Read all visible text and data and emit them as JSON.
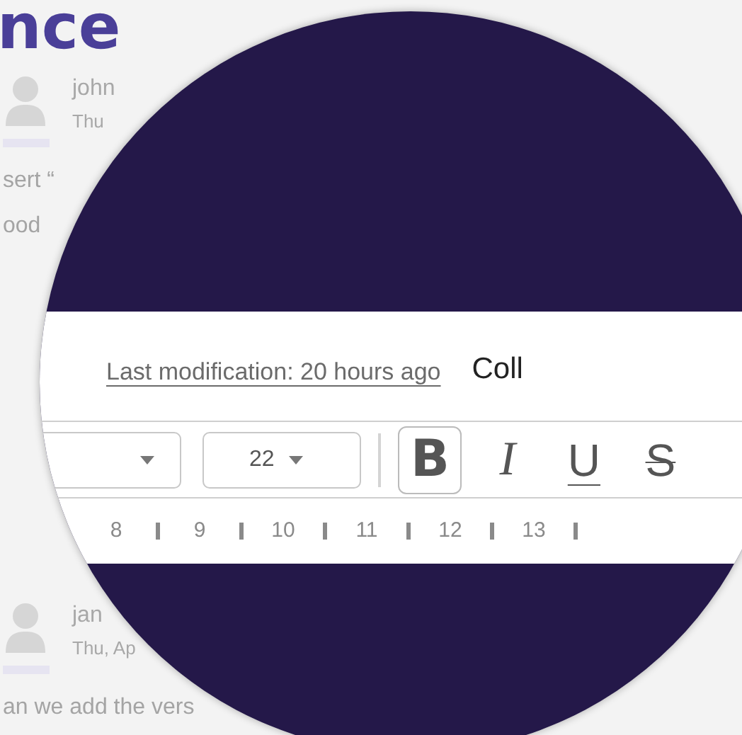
{
  "page_title": "nce",
  "comments": [
    {
      "author": "john",
      "date": "Thu",
      "lines": [
        "sert “",
        "ood"
      ]
    },
    {
      "author": "jan",
      "date": "Thu, Ap",
      "lines": [
        "an we add the vers"
      ]
    }
  ],
  "lens": {
    "modified_link": "Last modification: 20 hours ago",
    "heading": "Coll",
    "font_size": "22",
    "format_buttons": [
      {
        "kind": "bold",
        "label": "B",
        "selected": true
      },
      {
        "kind": "italic",
        "label": "I",
        "selected": false
      },
      {
        "kind": "underline",
        "label": "U",
        "selected": false
      },
      {
        "kind": "strike",
        "label": "S",
        "selected": false
      }
    ],
    "ruler": [
      "8",
      "9",
      "10",
      "11",
      "12",
      "13"
    ]
  }
}
